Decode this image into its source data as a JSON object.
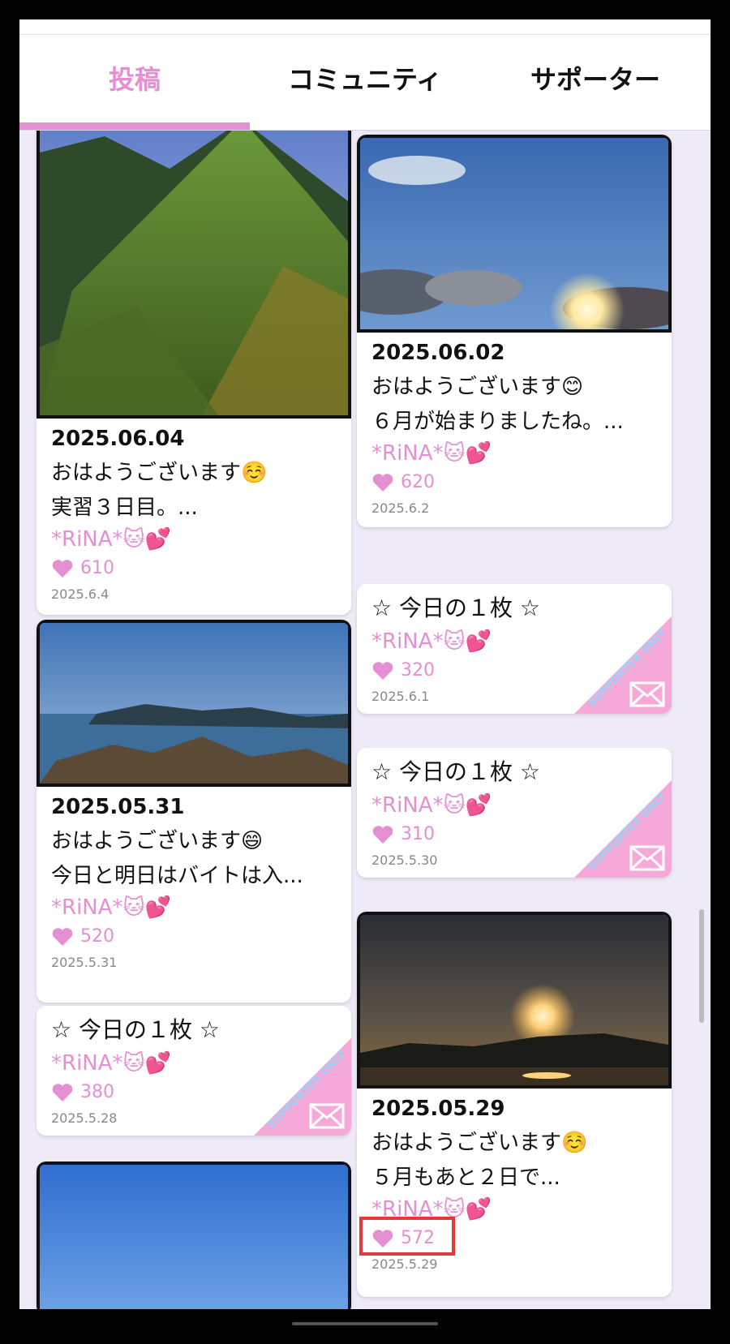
{
  "tabs": [
    {
      "label": "投稿",
      "active": true
    },
    {
      "label": "コミュニティ",
      "active": false
    },
    {
      "label": "サポーター",
      "active": false
    }
  ],
  "colors": {
    "accent": "#e58fd3",
    "highlight": "#e23a3a"
  },
  "posts_left": [
    {
      "date": "2025.06.04",
      "line1": "おはようございます☺️",
      "line2": "実習３日目。...",
      "author": "*RiNA*🐱💕",
      "likes": "610",
      "post_date": "2025.6.4",
      "photo": "mountain"
    },
    {
      "date": "2025.05.31",
      "line1": "おはようございます😄",
      "line2": "今日と明日はバイトは入...",
      "author": "*RiNA*🐱💕",
      "likes": "520",
      "post_date": "2025.5.31",
      "photo": "sea"
    },
    {
      "title": "☆ 今日の１枚 ☆",
      "author": "*RiNA*🐱💕",
      "likes": "380",
      "post_date": "2025.5.28",
      "badge": "SUPPORTER ONLY"
    }
  ],
  "posts_right": [
    {
      "date": "2025.06.02",
      "line1": "おはようございます😊",
      "line2": "６月が始まりましたね。...",
      "author": "*RiNA*🐱💕",
      "likes": "620",
      "post_date": "2025.6.2",
      "photo": "sky"
    },
    {
      "title": "☆ 今日の１枚 ☆",
      "author": "*RiNA*🐱💕",
      "likes": "320",
      "post_date": "2025.6.1",
      "badge": "SUPPORTER ONLY"
    },
    {
      "title": "☆ 今日の１枚 ☆",
      "author": "*RiNA*🐱💕",
      "likes": "310",
      "post_date": "2025.5.30",
      "badge": "SUPPORTER ONLY"
    },
    {
      "date": "2025.05.29",
      "line1": "おはようございます☺️",
      "line2": "５月もあと２日で...",
      "author": "*RiNA*🐱💕",
      "likes": "572",
      "post_date": "2025.5.29",
      "photo": "sunset",
      "highlighted": true
    }
  ]
}
